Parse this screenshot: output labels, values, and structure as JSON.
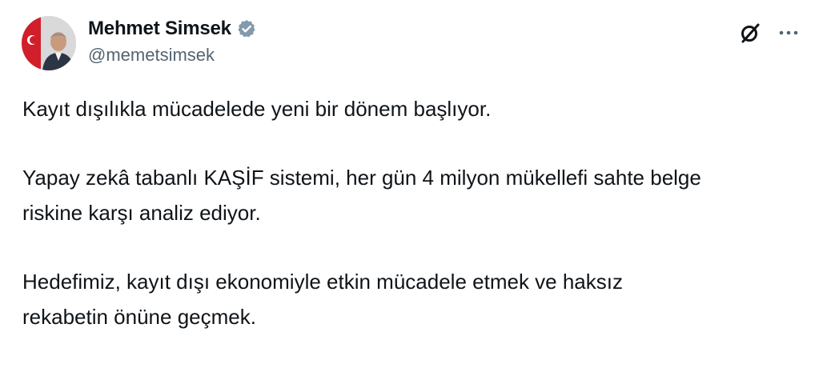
{
  "author": {
    "display_name": "Mehmet Simsek",
    "handle": "@memetsimsek",
    "verified": true,
    "verified_badge_color": "#829aab"
  },
  "actions": {
    "grok_icon": "grok-icon",
    "more_icon": "more-icon"
  },
  "tweet": {
    "paragraphs": [
      "Kayıt dışılıkla mücadelede yeni bir dönem başlıyor.",
      "Yapay zekâ tabanlı KAŞİF sistemi, her gün 4 milyon mükellefi sahte belge\nriskine karşı analiz ediyor.",
      "Hedefimiz, kayıt dışı ekonomiyle etkin mücadele etmek ve haksız\nrekabetin önüne geçmek."
    ]
  }
}
